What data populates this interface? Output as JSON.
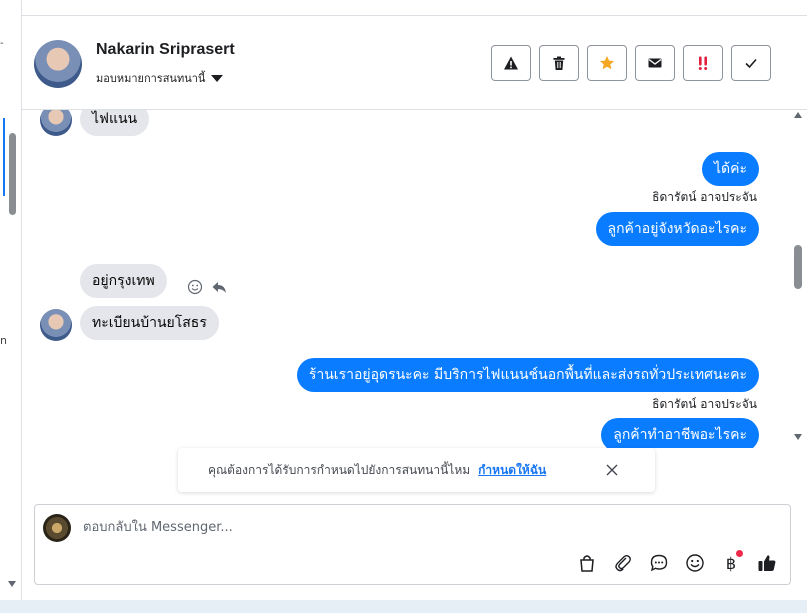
{
  "left_panel": {
    "fragment_top": "-",
    "fragment_mid": "n"
  },
  "header": {
    "name": "Nakarin Sriprasert",
    "assign_label": "มอบหมายการสนทนานี้",
    "actions": [
      {
        "icon": "warning-icon",
        "color": "#1c1e21"
      },
      {
        "icon": "trash-icon",
        "color": "#1c1e21"
      },
      {
        "icon": "star-icon",
        "color": "#f5a623"
      },
      {
        "icon": "mail-icon",
        "color": "#1c1e21"
      },
      {
        "icon": "urgent-icon",
        "color": "#e41e3f"
      },
      {
        "icon": "check-icon",
        "color": "#1c1e21"
      }
    ]
  },
  "thread": {
    "messages": [
      {
        "dir": "in",
        "text": "ไฟแนน"
      },
      {
        "dir": "out",
        "text": "ได้ค่ะ"
      },
      {
        "dir": "meta",
        "text": "ธิดารัตน์ อาจประจัน"
      },
      {
        "dir": "out",
        "text": "ลูกค้าอยู่จังหวัดอะไรคะ"
      },
      {
        "dir": "in",
        "text": "อยู่กรุงเทพ"
      },
      {
        "dir": "in",
        "text": "ทะเบียนบ้านยโสธร"
      },
      {
        "dir": "out",
        "text": "ร้านเราอยู่อุดรนะคะ มีบริการไฟแนนช์นอกพื้นที่และส่งรถทั่วประเทศนะคะ"
      },
      {
        "dir": "meta",
        "text": "ธิดารัตน์ อาจประจัน"
      },
      {
        "dir": "out",
        "text": "ลูกค้าทำอาชีพอะไรคะ"
      }
    ]
  },
  "notice": {
    "text": "คุณต้องการได้รับการกำหนดไปยังการสนทนานี้ไหม",
    "link": "กำหนดให้ฉัน"
  },
  "composer": {
    "placeholder": "ตอบกลับใน Messenger...",
    "currency_symbol": "฿",
    "tools": [
      "bag-icon",
      "paperclip-icon",
      "chat-bubble-icon",
      "emoji-icon",
      "baht-icon",
      "thumbs-up-icon"
    ]
  },
  "colors": {
    "accent": "#0a7cff",
    "incoming": "#e4e6eb",
    "link": "#1877f2"
  }
}
